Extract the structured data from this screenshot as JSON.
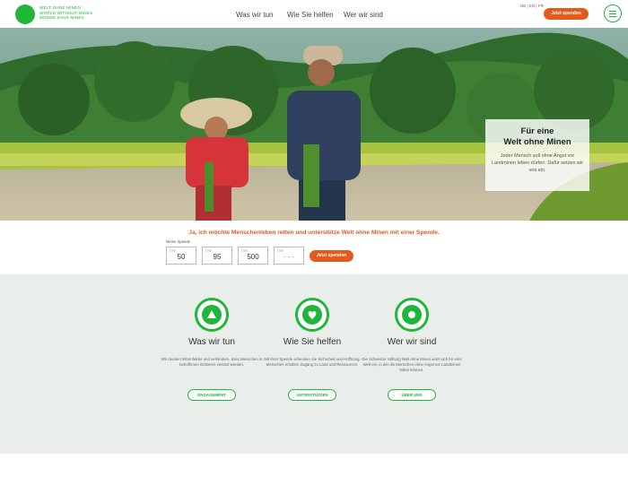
{
  "header": {
    "logo_lines": [
      "WELT OHNE MINEN",
      "WORLD WITHOUT MINES",
      "MONDE SANS MINES"
    ],
    "nav": [
      "Was wir tun",
      "Wie Sie helfen",
      "Wer wir sind"
    ],
    "lang": "DE | EN | FR",
    "donate_button": "Jetzt spenden",
    "menu_icon": "hamburger-icon"
  },
  "hero": {
    "title_line1": "Für eine",
    "title_line2": "Welt ohne Minen",
    "text": "Jeder Mensch soll ohne Angst vor Landminen leben dürfen. Dafür setzen wir uns ein."
  },
  "donation": {
    "headline": "Ja, ich möchte Menschenleben retten und unterstütze Welt ohne Minen mit einer Spende.",
    "label": "Meine Spende",
    "currency": "CHF",
    "amounts": [
      "50",
      "95",
      "500",
      "- - -"
    ],
    "button": "Jetzt spenden"
  },
  "info": {
    "columns": [
      {
        "icon": "triangle-icon",
        "title": "Was wir tun",
        "text": "Wir räumen Minenfelder und verhindern, dass Menschen in betroffenen Gebieten verletzt werden.",
        "button": "ENGAGEMENT"
      },
      {
        "icon": "heart-icon",
        "title": "Wie Sie helfen",
        "text": "Mit Ihrer Spende schenken Sie Sicherheit und Hoffnung. Menschen erhalten Zugang zu Land und Ressourcen.",
        "button": "UNTERSTÜTZEN"
      },
      {
        "icon": "dot-icon",
        "title": "Wer wir sind",
        "text": "Die Schweizer Stiftung Welt ohne Minen setzt sich für eine Welt ein, in der die Menschen ohne Angst vor Landminen leben können.",
        "button": "ÜBER UNS"
      }
    ]
  },
  "colors": {
    "brand_green": "#1fb63a",
    "accent_orange": "#e55a1c",
    "section_bg": "#eaeeea"
  }
}
